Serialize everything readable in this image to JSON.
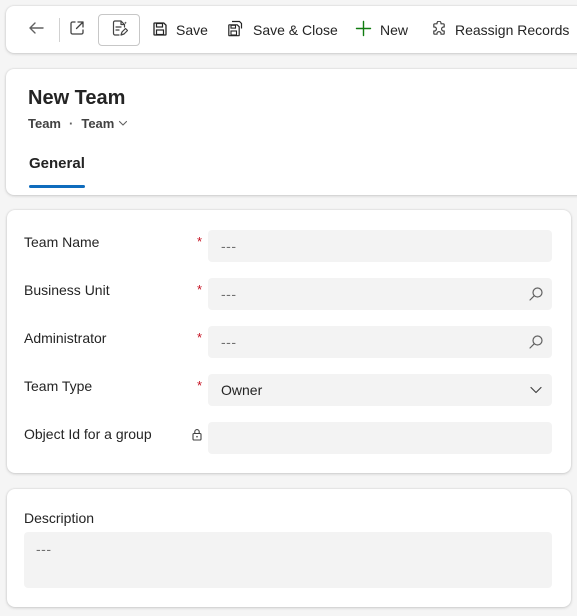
{
  "toolbar": {
    "back_icon": "arrow-left-icon",
    "popout_icon": "open-in-new-window-icon",
    "form_fill_icon": "form-fill-icon",
    "save_label": "Save",
    "save_close_label": "Save & Close",
    "new_label": "New",
    "reassign_label": "Reassign Records"
  },
  "header": {
    "title": "New Team",
    "entity": "Team",
    "separator": "·",
    "form_name": "Team"
  },
  "tabs": [
    {
      "label": "General",
      "selected": true
    }
  ],
  "fields": [
    {
      "label": "Team Name",
      "required": true,
      "value": "",
      "placeholder": "---",
      "type": "text"
    },
    {
      "label": "Business Unit",
      "required": true,
      "value": "",
      "placeholder": "---",
      "type": "lookup"
    },
    {
      "label": "Administrator",
      "required": true,
      "value": "",
      "placeholder": "---",
      "type": "lookup"
    },
    {
      "label": "Team Type",
      "required": true,
      "value": "Owner",
      "placeholder": "",
      "type": "select"
    },
    {
      "label": "Object Id for a group",
      "required": false,
      "locked": true,
      "value": "",
      "placeholder": "",
      "type": "text"
    }
  ],
  "required_marker": "*",
  "description": {
    "label": "Description",
    "placeholder": "---"
  },
  "colors": {
    "accent": "#0f6cbd",
    "required": "#c50f1f",
    "new_icon": "#107c10"
  }
}
